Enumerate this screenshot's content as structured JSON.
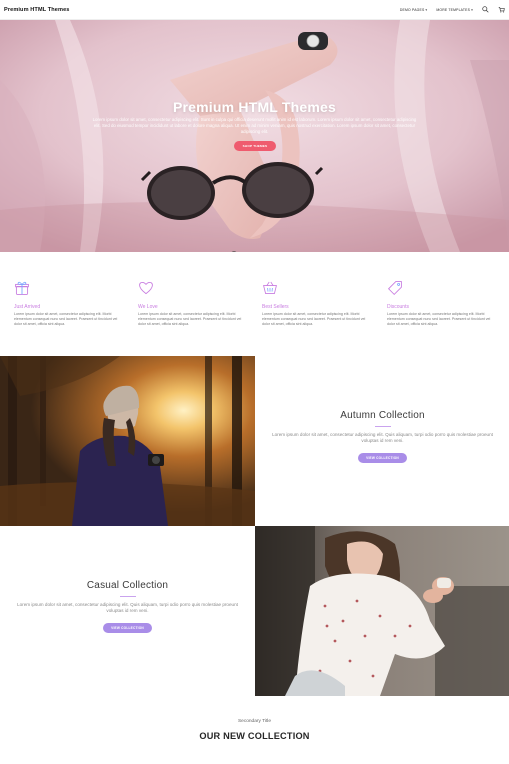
{
  "nav": {
    "brand": "Premium HTML Themes",
    "links": [
      {
        "label": "DEMO PAGES",
        "icon": "chevron-down-icon"
      },
      {
        "label": "MORE TEMPLATES",
        "icon": "chevron-down-icon"
      }
    ],
    "icons": [
      "search-icon",
      "cart-icon"
    ]
  },
  "hero": {
    "title": "Premium HTML Themes",
    "description": "Lorem ipsum dolor sit amet, consectetur adipiscing elit. Sunt in culpa qui officia deserunt mollit anim id est laborum. Lorem ipsum dolor sit amet, consectetur adipiscing elit. Sed do eiusmod tempor incididunt ut labore et dolore magna aliqua. Ut enim ad minim veniam, quis nostrud exercitation. Lorem ipsum dolor sit amet, consectetur adipiscing elit.",
    "button": "SHOP THEMES"
  },
  "features": [
    {
      "icon": "gift-icon",
      "title": "Just Arrived",
      "text": "Lorem ipsum dolor sit amet, consectetur adipiscing elit. Morbi elementum consequat nunc sed laoreet. Praesent ut tincidunt vel dolor sit amet, officia sint aliqua."
    },
    {
      "icon": "heart-icon",
      "title": "We Love",
      "text": "Lorem ipsum dolor sit amet, consectetur adipiscing elit. Morbi elementum consequat nunc sed laoreet. Praesent ut tincidunt vel dolor sit amet, officia sint aliqua."
    },
    {
      "icon": "basket-icon",
      "title": "Best Sellers",
      "text": "Lorem ipsum dolor sit amet, consectetur adipiscing elit. Morbi elementum consequat nunc sed laoreet. Praesent ut tincidunt vel dolor sit amet, officia sint aliqua."
    },
    {
      "icon": "tag-icon",
      "title": "Discounts",
      "text": "Lorem ipsum dolor sit amet, consectetur adipiscing elit. Morbi elementum consequat nunc sed laoreet. Praesent ut tincidunt vel dolor sit amet, officia sint aliqua."
    }
  ],
  "autumn": {
    "title": "Autumn Collection",
    "description": "Lorem ipsum dolor sit amet, consectetur adipiscing elit. Quis aliquam, turpi odio porro quis molestiae proeunt voluptas id rem veni.",
    "button": "VIEW COLLECTION"
  },
  "casual": {
    "title": "Casual Collection",
    "description": "Lorem ipsum dolor sit amet, consectetur adipiscing elit. Quis aliquam, turpi odio porro quis molestiae proeunt voluptas id rem veni.",
    "button": "VIEW COLLECTION"
  },
  "secondary": {
    "subtitle": "Secondary Title",
    "title": "OUR NEW COLLECTION"
  },
  "colors": {
    "accent": "#a98de8",
    "hero_button": "#ef5b6e",
    "feature_title": "#c87ce0"
  }
}
